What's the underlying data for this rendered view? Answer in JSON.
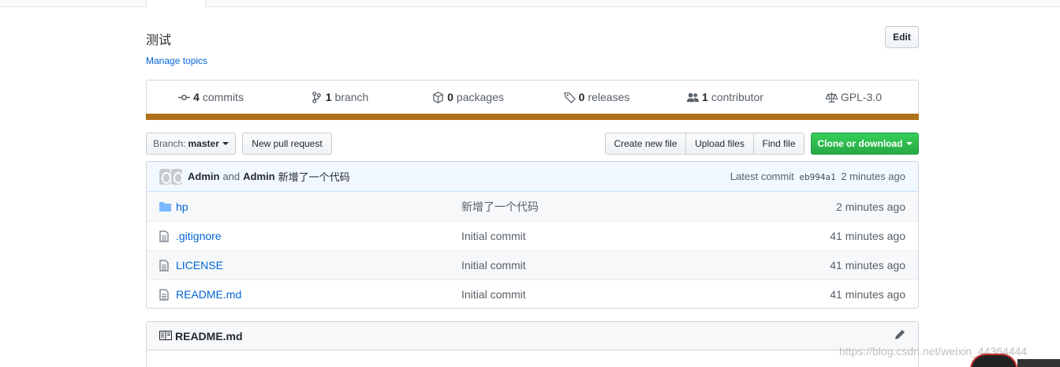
{
  "repo": {
    "description": "测试",
    "manage_topics": "Manage topics",
    "edit_label": "Edit"
  },
  "summary": {
    "commits": {
      "count": "4",
      "label": "commits"
    },
    "branches": {
      "count": "1",
      "label": "branch"
    },
    "packages": {
      "count": "0",
      "label": "packages"
    },
    "releases": {
      "count": "0",
      "label": "releases"
    },
    "contributors": {
      "count": "1",
      "label": "contributor"
    },
    "license": "GPL-3.0",
    "language_color": "#b07219"
  },
  "toolbar": {
    "branch_label": "Branch:",
    "branch_value": "master",
    "new_pull_request": "New pull request",
    "create_new_file": "Create new file",
    "upload_files": "Upload files",
    "find_file": "Find file",
    "clone_or_download": "Clone or download"
  },
  "latest_commit": {
    "author1": "Admin",
    "and": "and",
    "author2": "Admin",
    "message": "新增了一个代码",
    "prefix": "Latest commit",
    "sha": "eb994a1",
    "age": "2 minutes ago"
  },
  "files": [
    {
      "name": "hp",
      "type": "folder",
      "message": "新增了一个代码",
      "age": "2 minutes ago"
    },
    {
      "name": ".gitignore",
      "type": "file",
      "message": "Initial commit",
      "age": "41 minutes ago"
    },
    {
      "name": "LICENSE",
      "type": "file",
      "message": "Initial commit",
      "age": "41 minutes ago"
    },
    {
      "name": "README.md",
      "type": "file",
      "message": "Initial commit",
      "age": "41 minutes ago"
    }
  ],
  "readme": {
    "title": "README.md"
  },
  "watermark": "https://blog.csdn.net/weixin_44364444",
  "colors": {
    "link": "#0366d6",
    "primary_green": "#28a745",
    "commit_bg": "#f1f8ff"
  }
}
